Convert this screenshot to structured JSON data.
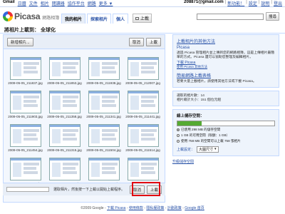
{
  "gbar": {
    "links": [
      "Gmail",
      "日曆",
      "文件",
      "相片",
      "閱讀器",
      "協作平台",
      "網路",
      "更多 ▼"
    ],
    "email": "208871@gmail.com",
    "user_links": [
      "新功能！",
      "設定",
      "說明",
      "登出"
    ]
  },
  "header": {
    "logo_text": "Picasa",
    "logo_sub": "網路相簿",
    "tabs": [
      "我的相片",
      "探索相片",
      "個人",
      "搜尋"
    ],
    "upload_label": "上載",
    "search_placeholder": "",
    "search_button": "搜尋"
  },
  "page": {
    "title": "將相片上載到：  全球化"
  },
  "main": {
    "add_photos_button": "新增相片...",
    "cancel_button": "取消",
    "upload_button": "上載",
    "thumbnails": [
      "2009-05-05_211837.jpg",
      "2009-05-05_211853.jpg",
      "2009-05-05_211938.jpg",
      "2009-05-05_212007.jpg",
      "2009-05-05_211903.jpg",
      "2009-05-05_211358.jpg",
      "2009-05-05_211341.jpg",
      "2009-05-05_211441.jpg",
      "2009-05-05_211454.jpg",
      "2009-05-05_211315.jpg",
      "2009-05-05_211504.jpg",
      "2009-05-05_211514.jpg",
      "2009-05-05_211618.jpg",
      "2009-05-05_211534.jpg",
      "2009-05-05_211453.jpg",
      "2009-05-05_211651.jpg"
    ],
    "status_text": "選取相片，然後按一下上載以開始上載程序。",
    "bottom_cancel": "取消",
    "bottom_upload": "上載"
  },
  "sidebar": {
    "faster_title": "上載相片的其他方法",
    "picasa_title": "Picasa",
    "picasa_text": "透過 Picasa 管理相片並上傳到您的網路相簿，這是上傳相片最簡單的方式。Picasa 還可以協助您整理及編輯相片。",
    "picasa_link": "下載 Picasa",
    "other_link": "使用 Picasa 其他方法",
    "simple_title": "簡易網路上載表格",
    "simple_text": "若要大量上載相片，請使用其他方法或下載 Picasa。",
    "count_text": "選取的相片數：14",
    "space_text": "相片總計大小：151 個位元組",
    "storage_title": "線上儲存空間：",
    "storage_fill": 0.25,
    "storage_lines": [
      "已使用 298 MB 的儲存空間",
      "1 GB 的可用空間（限額：1 GB）",
      "使用 758 MB 的空間可以上載 758 張相片"
    ],
    "upload_size_label": "上載設定：",
    "upload_size_value": "大圖尺寸",
    "upgrade_link": "升級儲存空間"
  },
  "footer": {
    "copyright": "©2009 Google",
    "links": [
      "下載 Picasa",
      "使用條款",
      "隱私權政策",
      "計劃政策",
      "Google 首頁"
    ]
  }
}
